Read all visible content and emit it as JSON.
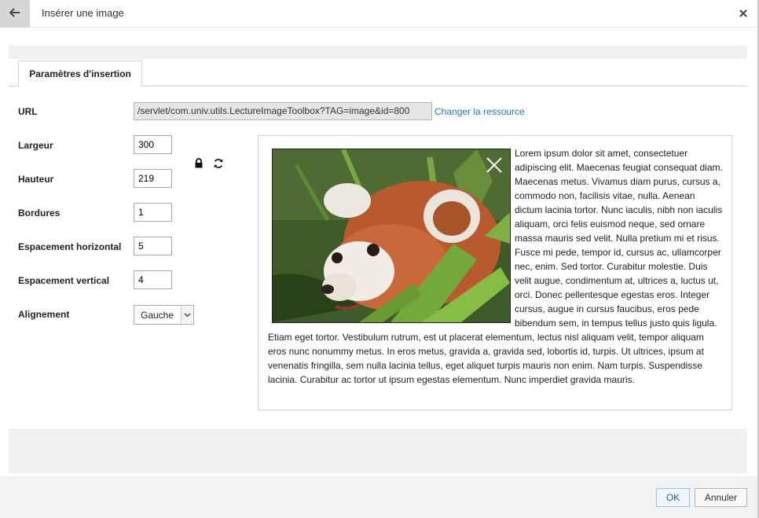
{
  "dialog": {
    "title": "Insérer une image"
  },
  "tab": {
    "label": "Paramètres d'insertion"
  },
  "form": {
    "url_label": "URL",
    "url_value": "/servlet/com.univ.utils.LectureImageToolbox?TAG=image&id=800",
    "change_link": "Changer la ressource",
    "width_label": "Largeur",
    "width_value": "300",
    "height_label": "Hauteur",
    "height_value": "219",
    "border_label": "Bordures",
    "border_value": "1",
    "hspace_label": "Espacement horizontal",
    "hspace_value": "5",
    "vspace_label": "Espacement vertical",
    "vspace_value": "4",
    "align_label": "Alignement",
    "align_value": "Gauche"
  },
  "preview": {
    "text": "Lorem ipsum dolor sit amet, consectetuer adipiscing elit. Maecenas feugiat consequat diam. Maecenas metus. Vivamus diam purus, cursus a, commodo non, facilisis vitae, nulla. Aenean dictum lacinia tortor. Nunc iaculis, nibh non iaculis aliquam, orci felis euismod neque, sed ornare massa mauris sed velit. Nulla pretium mi et risus. Fusce mi pede, tempor id, cursus ac, ullamcorper nec, enim. Sed tortor. Curabitur molestie. Duis velit augue, condimentum at, ultrices a, luctus ut, orci. Donec pellentesque egestas eros. Integer cursus, augue in cursus faucibus, eros pede bibendum sem, in tempus tellus justo quis ligula. Etiam eget tortor. Vestibulum rutrum, est ut placerat elementum, lectus nisl aliquam velit, tempor aliquam eros nunc nonummy metus. In eros metus, gravida a, gravida sed, lobortis id, turpis. Ut ultrices, ipsum at venenatis fringilla, sem nulla lacinia tellus, eget aliquet turpis mauris non enim. Nam turpis. Suspendisse lacinia. Curabitur ac tortor ut ipsum egestas elementum. Nunc imperdiet gravida mauris."
  },
  "buttons": {
    "ok": "OK",
    "cancel": "Annuler"
  },
  "icons": {
    "back": "arrow-left-icon",
    "close": "close-icon",
    "lock": "lock-icon",
    "reset": "refresh-icon",
    "image_remove": "close-icon",
    "select_arrow": "chevron-down-icon"
  },
  "colors": {
    "link": "#1a7bb9",
    "band": "#f0f1f2"
  }
}
